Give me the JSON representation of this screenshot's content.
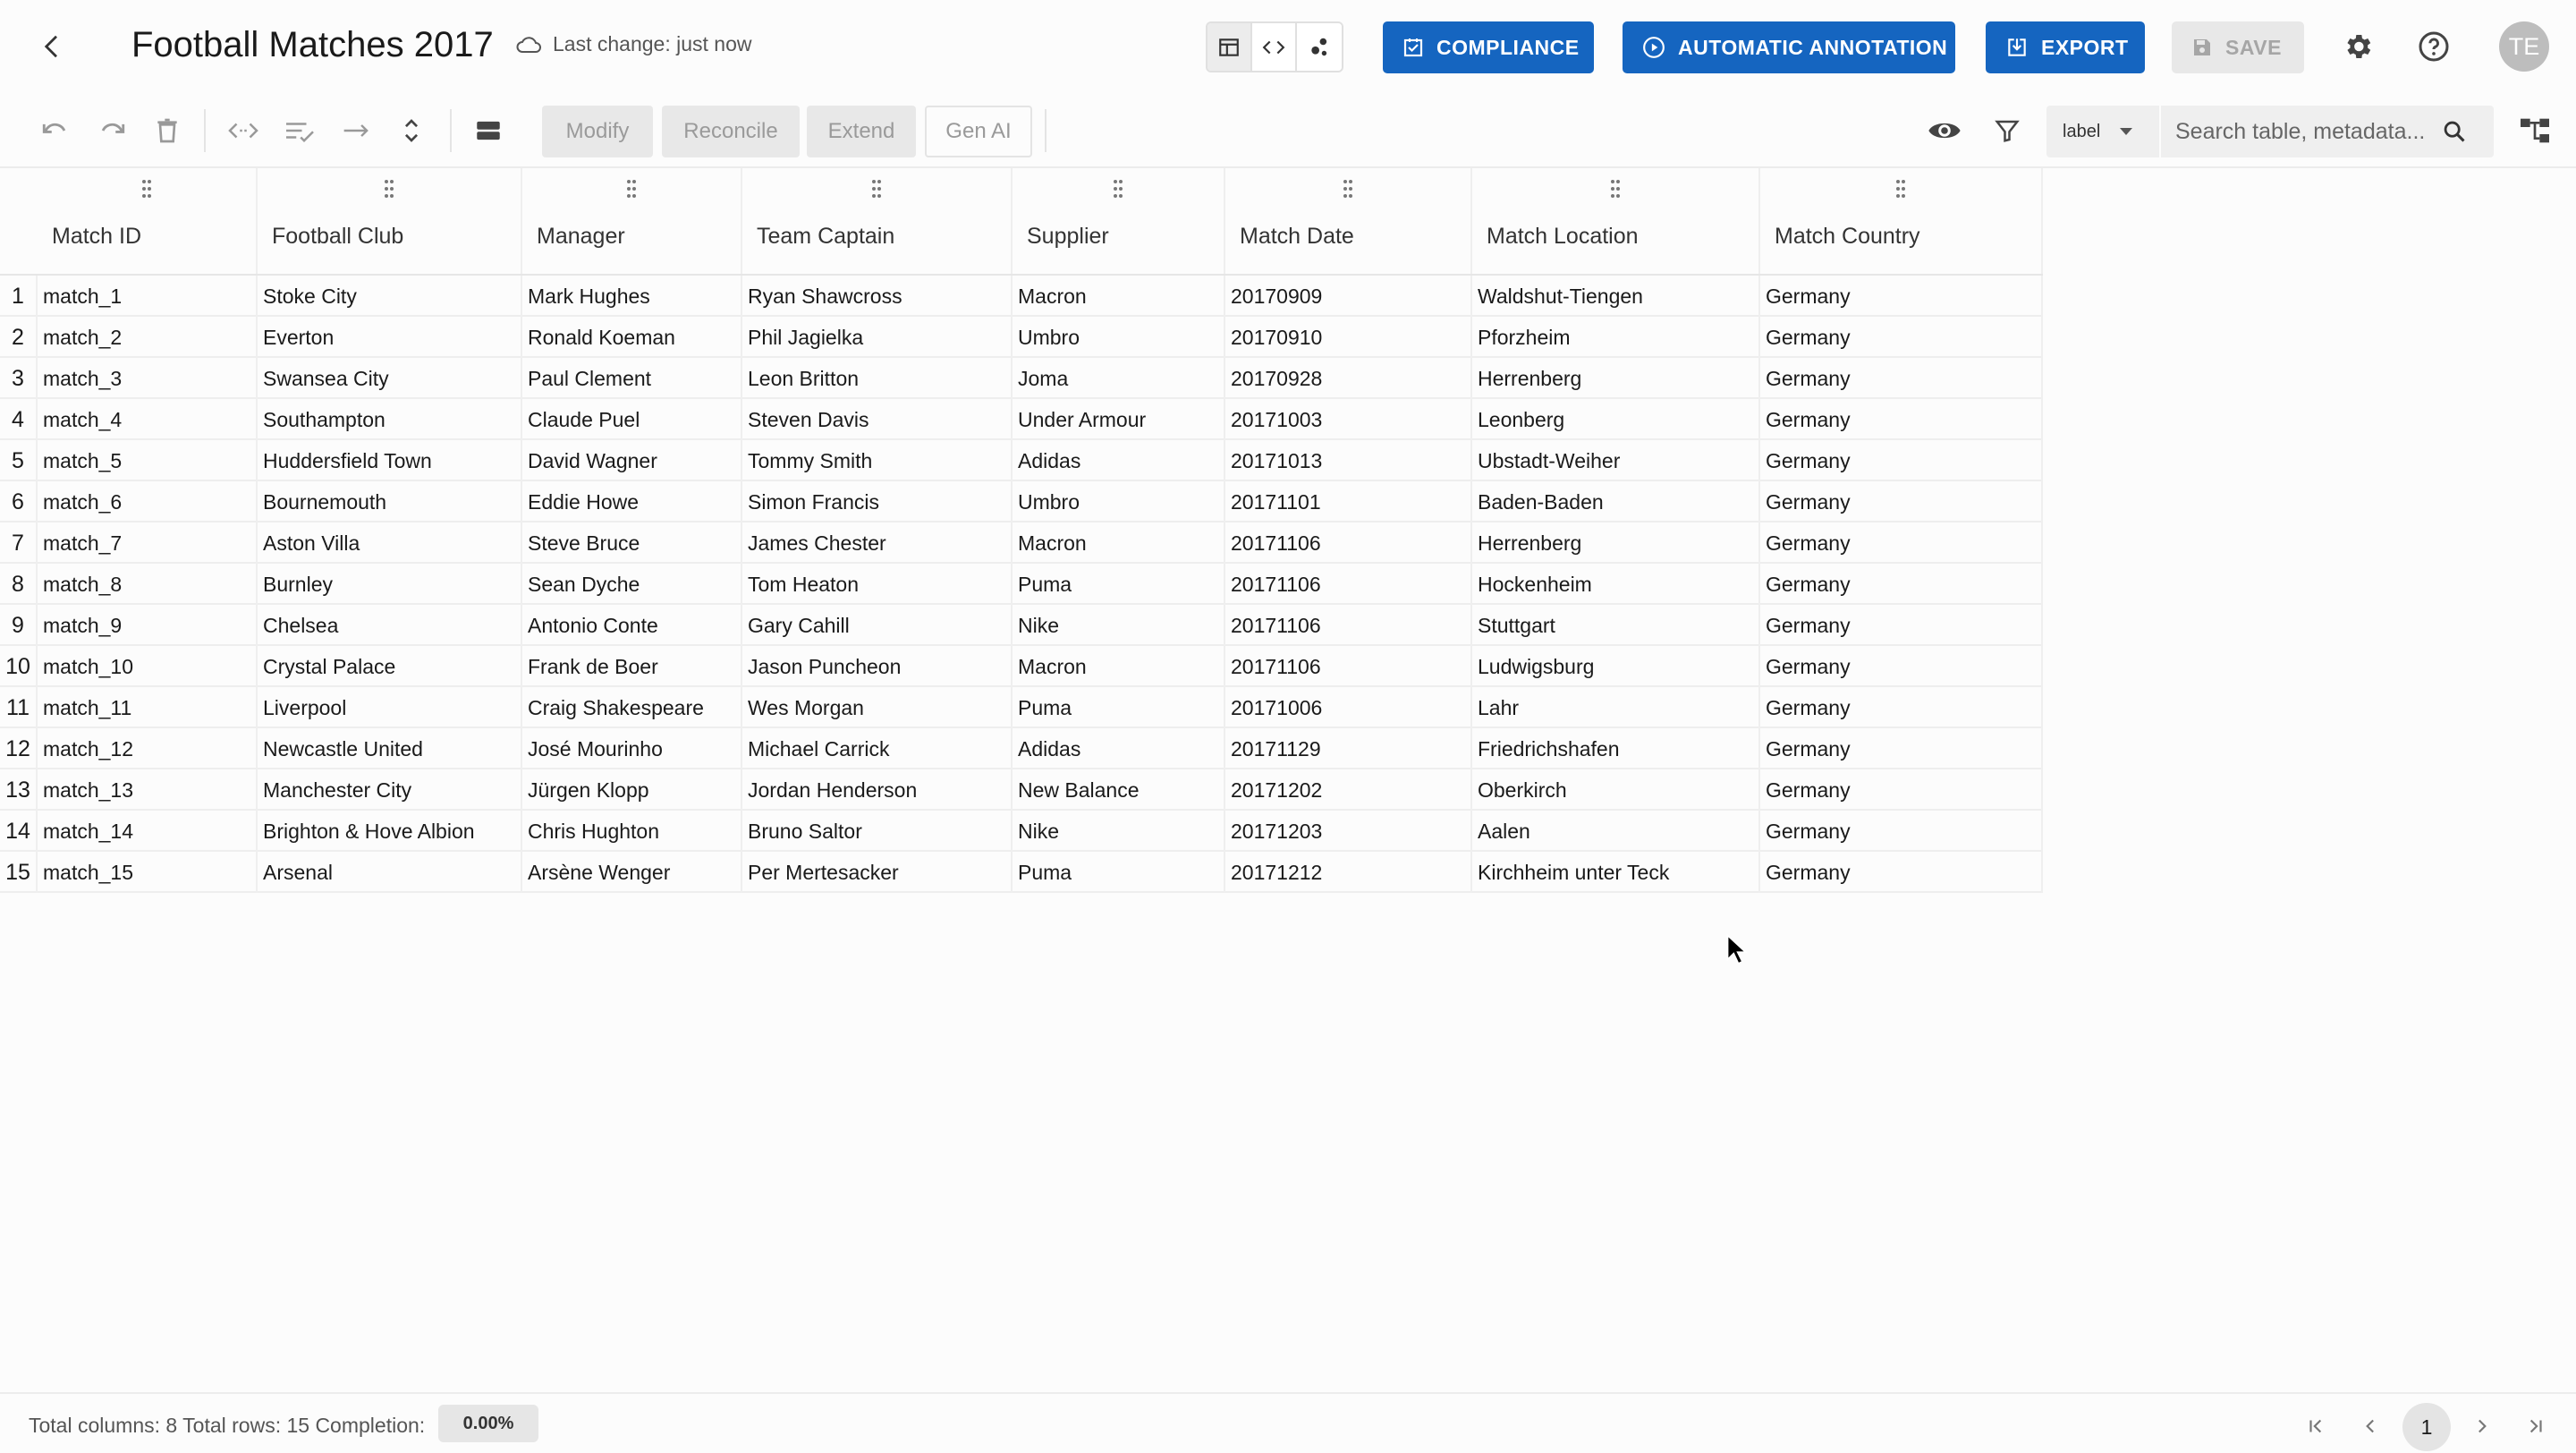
{
  "header": {
    "title": "Football Matches 2017",
    "last_change": "Last change: just now",
    "buttons": {
      "compliance": "COMPLIANCE",
      "automatic_annotation": "AUTOMATIC ANNOTATION",
      "export": "EXPORT",
      "save": "SAVE"
    },
    "avatar_initials": "TE",
    "accent_color": "#1565c0"
  },
  "toolbar": {
    "actions": {
      "modify": "Modify",
      "reconcile": "Reconcile",
      "extend": "Extend",
      "gen_ai": "Gen AI"
    },
    "label_select": "label",
    "search_placeholder": "Search table, metadata..."
  },
  "table": {
    "columns": [
      "Match ID",
      "Football Club",
      "Manager",
      "Team Captain",
      "Supplier",
      "Match Date",
      "Match Location",
      "Match Country"
    ],
    "rows": [
      {
        "index": "1",
        "cells": [
          "match_1",
          "Stoke City",
          "Mark Hughes",
          "Ryan Shawcross",
          "Macron",
          "20170909",
          "Waldshut-Tiengen",
          "Germany"
        ]
      },
      {
        "index": "2",
        "cells": [
          "match_2",
          "Everton",
          "Ronald Koeman",
          "Phil Jagielka",
          "Umbro",
          "20170910",
          "Pforzheim",
          "Germany"
        ]
      },
      {
        "index": "3",
        "cells": [
          "match_3",
          "Swansea City",
          "Paul Clement",
          "Leon Britton",
          "Joma",
          "20170928",
          "Herrenberg",
          "Germany"
        ]
      },
      {
        "index": "4",
        "cells": [
          "match_4",
          "Southampton",
          "Claude Puel",
          "Steven Davis",
          "Under Armour",
          "20171003",
          "Leonberg",
          "Germany"
        ]
      },
      {
        "index": "5",
        "cells": [
          "match_5",
          "Huddersfield Town",
          "David Wagner",
          "Tommy Smith",
          "Adidas",
          "20171013",
          "Ubstadt-Weiher",
          "Germany"
        ]
      },
      {
        "index": "6",
        "cells": [
          "match_6",
          "Bournemouth",
          "Eddie Howe",
          "Simon Francis",
          "Umbro",
          "20171101",
          "Baden-Baden",
          "Germany"
        ]
      },
      {
        "index": "7",
        "cells": [
          "match_7",
          "Aston Villa",
          "Steve Bruce",
          "James Chester",
          "Macron",
          "20171106",
          "Herrenberg",
          "Germany"
        ]
      },
      {
        "index": "8",
        "cells": [
          "match_8",
          "Burnley",
          "Sean Dyche",
          "Tom Heaton",
          "Puma",
          "20171106",
          "Hockenheim",
          "Germany"
        ]
      },
      {
        "index": "9",
        "cells": [
          "match_9",
          "Chelsea",
          "Antonio Conte",
          "Gary Cahill",
          "Nike",
          "20171106",
          "Stuttgart",
          "Germany"
        ]
      },
      {
        "index": "10",
        "cells": [
          "match_10",
          "Crystal Palace",
          "Frank de Boer",
          "Jason Puncheon",
          "Macron",
          "20171106",
          "Ludwigsburg",
          "Germany"
        ]
      },
      {
        "index": "11",
        "cells": [
          "match_11",
          "Liverpool",
          "Craig Shakespeare",
          "Wes Morgan",
          "Puma",
          "20171006",
          "Lahr",
          "Germany"
        ]
      },
      {
        "index": "12",
        "cells": [
          "match_12",
          "Newcastle United",
          "José Mourinho",
          "Michael Carrick",
          "Adidas",
          "20171129",
          "Friedrichshafen",
          "Germany"
        ]
      },
      {
        "index": "13",
        "cells": [
          "match_13",
          "Manchester City",
          "Jürgen Klopp",
          "Jordan Henderson",
          "New Balance",
          "20171202",
          "Oberkirch",
          "Germany"
        ]
      },
      {
        "index": "14",
        "cells": [
          "match_14",
          "Brighton & Hove Albion",
          "Chris Hughton",
          "Bruno Saltor",
          "Nike",
          "20171203",
          "Aalen",
          "Germany"
        ]
      },
      {
        "index": "15",
        "cells": [
          "match_15",
          "Arsenal",
          "Arsène Wenger",
          "Per Mertesacker",
          "Puma",
          "20171212",
          "Kirchheim unter Teck",
          "Germany"
        ]
      }
    ]
  },
  "footer": {
    "summary": "Total columns: 8 Total rows: 15 Completion:",
    "completion": "0.00%",
    "current_page": "1"
  }
}
